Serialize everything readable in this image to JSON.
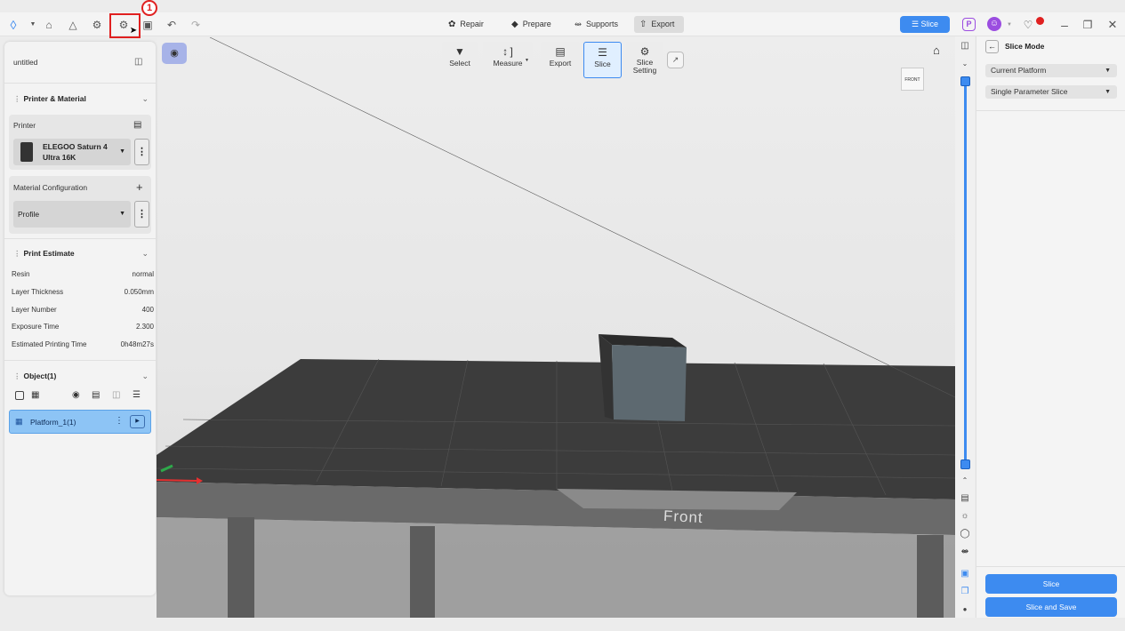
{
  "toolbar": {
    "step_number": "1",
    "modes": [
      {
        "label": "Repair",
        "icon": "wrench-icon"
      },
      {
        "label": "Prepare",
        "icon": "cube-icon"
      },
      {
        "label": "Supports",
        "icon": "support-icon"
      },
      {
        "label": "Export",
        "icon": "export-icon",
        "active": true
      }
    ],
    "slice_button": "Slice"
  },
  "left_panel": {
    "project_name": "untitled",
    "printer_material": {
      "title": "Printer & Material",
      "printer_label": "Printer",
      "printer_name_line1": "ELEGOO Saturn 4",
      "printer_name_line2": "Ultra 16K",
      "material_label": "Material Configuration",
      "profile_value": "Profile"
    },
    "print_estimate": {
      "title": "Print Estimate",
      "rows": [
        {
          "label": "Resin",
          "value": "normal"
        },
        {
          "label": "Layer Thickness",
          "value": "0.050mm"
        },
        {
          "label": "Layer Number",
          "value": "400"
        },
        {
          "label": "Exposure Time",
          "value": "2.300"
        },
        {
          "label": "Estimated Printing Time",
          "value": "0h48m27s"
        }
      ]
    },
    "objects": {
      "title": "Object(1)",
      "platform_item": "Platform_1(1)"
    }
  },
  "viewport_toolbar": {
    "select": "Select",
    "measure": "Measure",
    "export": "Export",
    "slice": "Slice",
    "slice_setting_line1": "Slice",
    "slice_setting_line2": "Setting"
  },
  "viewport": {
    "cube_face_label": "FRONT",
    "plate_label": "Front"
  },
  "right_panel": {
    "title": "Slice Mode",
    "platform_select": "Current Platform",
    "slice_type_select": "Single Parameter Slice",
    "slice_button": "Slice",
    "slice_save_button": "Slice and Save"
  },
  "colors": {
    "accent": "#3d8bf0",
    "highlight": "#e02020",
    "platform_selected": "#8dc4f5"
  }
}
